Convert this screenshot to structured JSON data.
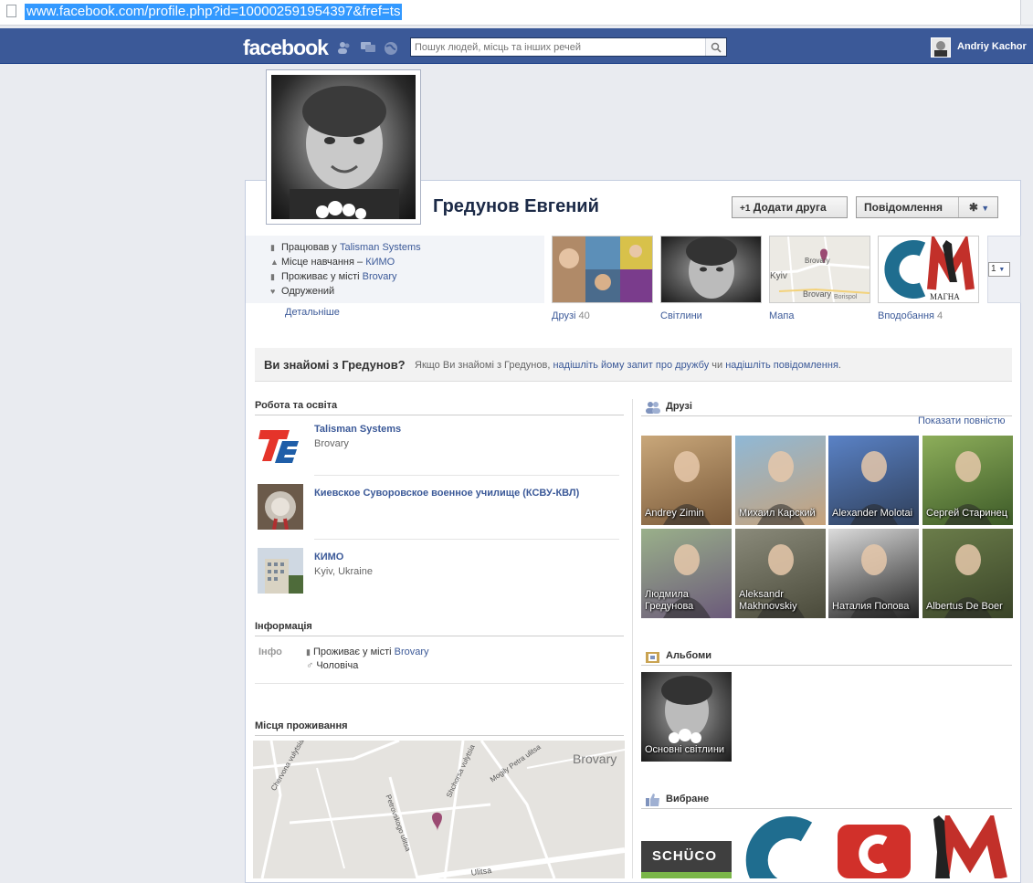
{
  "browser": {
    "url": "www.facebook.com/profile.php?id=100002591954397&fref=ts"
  },
  "topnav": {
    "logo": "facebook",
    "search_placeholder": "Пошук людей, місць та інших речей",
    "user_name": "Andriy Kachor",
    "icons": [
      "friend-requests-icon",
      "messages-icon",
      "notifications-globe-icon",
      "search-icon"
    ]
  },
  "profile": {
    "name": "Гредунов Евгений",
    "add_friend_label": "Додати друга",
    "message_label": "Повідомлення",
    "info": [
      {
        "prefix": "Працював у ",
        "link": "Talisman Systems"
      },
      {
        "prefix": "Місце навчання – ",
        "link": "КИМО"
      },
      {
        "prefix": "Проживає у місті ",
        "link": "Brovary"
      },
      {
        "prefix": "Одружений",
        "link": ""
      }
    ],
    "details_link": "Детальніше",
    "tiles": {
      "friends_label": "Друзі",
      "friends_count": "40",
      "photos_label": "Світлини",
      "map_label": "Мапа",
      "map_places": [
        "Brovary",
        "Kyiv",
        "Brovary",
        "Borispol"
      ],
      "likes_label": "Вподобання",
      "likes_count": "4",
      "likes_logo_text": "МАГНА",
      "more_select": "1"
    }
  },
  "know_banner": {
    "question": "Ви знайомі з Гредунов?",
    "text_before": "Якщо Ви знайомі з Гредунов, ",
    "link1": "надішліть йому запит про дружбу",
    "text_mid": " чи ",
    "link2": "надішліть повідомлення",
    "text_after": "."
  },
  "work_education": {
    "title": "Робота та освіта",
    "items": [
      {
        "name": "Talisman Systems",
        "sub": "Brovary"
      },
      {
        "name": "Киевское Суворовское военное училище (КСВУ-КВЛ)",
        "sub": ""
      },
      {
        "name": "КИМО",
        "sub": "Kyiv, Ukraine"
      }
    ]
  },
  "information": {
    "title": "Інформація",
    "label": "Інфо",
    "lines": [
      {
        "prefix": "Проживає у місті ",
        "link": "Brovary"
      },
      {
        "prefix": "Чоловіча",
        "link": ""
      }
    ]
  },
  "places": {
    "title": "Місця проживання",
    "map_labels": [
      "Brovary",
      "Chervona vulytsia",
      "Shchorsa vulytsia",
      "Mogily Petra ulitsa",
      "Petrovskogo ulitsa",
      "Ulitsa"
    ]
  },
  "friends_section": {
    "title": "Друзі",
    "show_all": "Показати повністю",
    "friends": [
      {
        "name": "Andrey Zimin",
        "c1": "#c9a77a",
        "c2": "#7a5a3a"
      },
      {
        "name": "Михаил Карский",
        "c1": "#8fb8d6",
        "c2": "#c7a27a"
      },
      {
        "name": "Alexander Molotai",
        "c1": "#5a82c6",
        "c2": "#2f3f5a"
      },
      {
        "name": "Сергей Старинец",
        "c1": "#8dae5a",
        "c2": "#3d5a28"
      },
      {
        "name": "Людмила Гредунова",
        "c1": "#9ab08a",
        "c2": "#6b5a7a"
      },
      {
        "name": "Aleksandr Makhnovskiy",
        "c1": "#8a8a7a",
        "c2": "#4a4a3a"
      },
      {
        "name": "Наталия Попова",
        "c1": "#dcdcdc",
        "c2": "#222222"
      },
      {
        "name": "Albertus De Boer",
        "c1": "#6b7d4a",
        "c2": "#3a4428"
      }
    ]
  },
  "albums_section": {
    "title": "Альбоми",
    "albums": [
      {
        "name": "Основні світлини"
      }
    ]
  },
  "favorites_section": {
    "title": "Вибране",
    "items": [
      "SCHÜCO",
      "C",
      "C",
      "M"
    ]
  }
}
